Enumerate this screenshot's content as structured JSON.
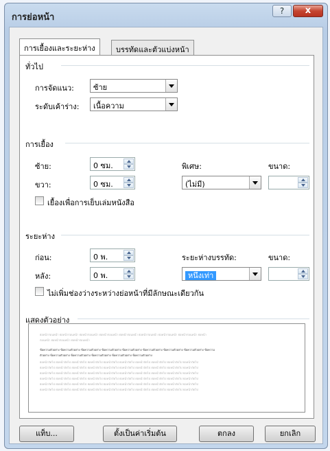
{
  "window": {
    "title": "การย่อหน้า",
    "help_label": "?",
    "close_label": "x"
  },
  "tabs": [
    {
      "label": "การเยื้องและระยะห่าง"
    },
    {
      "label": "บรรทัดและตัวแบ่งหน้า"
    }
  ],
  "general": {
    "heading": "ทั่วไป",
    "alignment_label": "การจัดแนว:",
    "alignment_value": "ซ้าย",
    "outline_label": "ระดับเค้าร่าง:",
    "outline_value": "เนื้อความ"
  },
  "indentation": {
    "heading": "การเยื้อง",
    "left_label": "ซ้าย:",
    "left_value": "0 ซม.",
    "right_label": "ขวา:",
    "right_value": "0 ซม.",
    "special_label": "พิเศษ:",
    "special_value": "(ไม่มี)",
    "by_label": "ขนาด:",
    "by_value": "",
    "mirror_label": "เยื้องเพื่อการเย็บเล่มหนังสือ"
  },
  "spacing": {
    "heading": "ระยะห่าง",
    "before_label": "ก่อน:",
    "before_value": "0 พ.",
    "after_label": "หลัง:",
    "after_value": "0 พ.",
    "line_label": "ระยะห่างบรรทัด:",
    "line_value": "หนึ่งเท่า",
    "at_label": "ขนาด:",
    "at_value": "",
    "dont_add_label": "ไม่เพิ่มช่องว่างระหว่างย่อหน้าที่มีลักษณะเดียวกัน"
  },
  "preview": {
    "heading": "แสดงตัวอย่าง",
    "prev_line_1": "ย่อหน้าก่อนหน้า ย่อหน้าก่อนหน้า ย่อหน้าก่อนหน้า ย่อหน้าก่อนหน้า ย่อหน้าก่อนหน้า ย่อหน้าก่อนหน้า ย่อหน้าก่อนหน้า ย่อหน้าก่อนหน้า ย่อหน้า",
    "prev_line_2": "ก่อนหน้า ย่อหน้าก่อนหน้า ย่อหน้าก่อนหน้า",
    "sample_line_1": "ข้อความตัวอย่าง ข้อความตัวอย่าง ข้อความตัวอย่าง ข้อความตัวอย่าง ข้อความตัวอย่าง ข้อความตัวอย่าง ข้อความตัวอย่าง ข้อความตัวอย่าง ข้อความ",
    "sample_line_2": "ตัวอย่าง ข้อความตัวอย่าง ข้อความตัวอย่าง ข้อความตัวอย่าง ข้อความตัวอย่าง ข้อความตัวอย่าง",
    "next_line": "ย่อหน้าถัดไป ย่อหน้าถัดไป ย่อหน้าถัดไป ย่อหน้าถัดไป ย่อหน้าถัดไป ย่อหน้าถัดไป ย่อหน้าถัดไป ย่อหน้าถัดไป ย่อหน้าถัดไป ย่อหน้าถัดไป"
  },
  "buttons": {
    "tabs_label": "แท็บ...",
    "default_label": "ตั้งเป็นค่าเริ่มต้น",
    "ok_label": "ตกลง",
    "cancel_label": "ยกเลิก"
  }
}
